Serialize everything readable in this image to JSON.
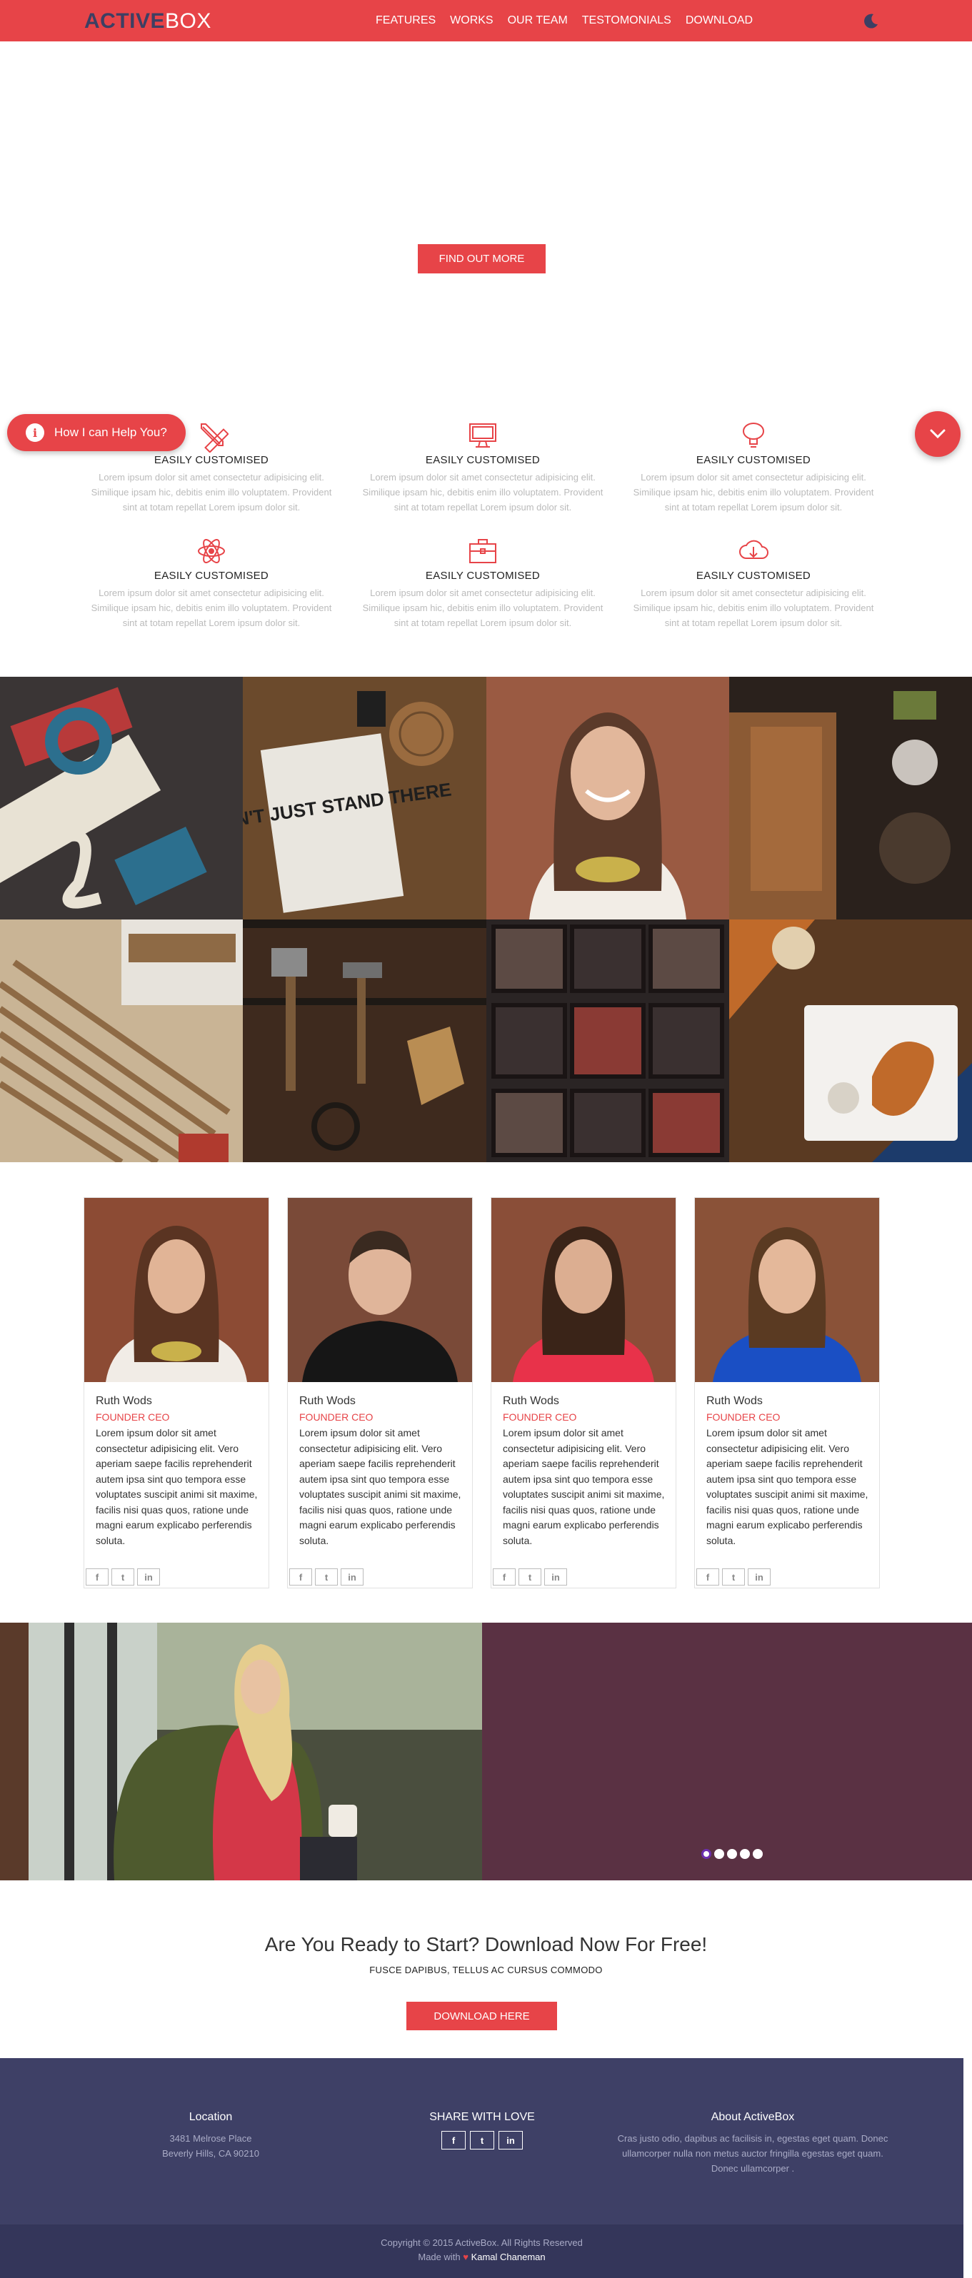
{
  "nav": {
    "logo_part1": "ACTIVE",
    "logo_part2": "BOX",
    "items": [
      "FEATURES",
      "WORKS",
      "OUR TEAM",
      "TESTOMONIALS",
      "DOWNLOAD"
    ],
    "theme_icon": "moon-icon"
  },
  "hero": {
    "button_label": "FIND OUT MORE"
  },
  "help_widget": {
    "label": "How I can Help You?",
    "icon": "info-icon"
  },
  "features": [
    {
      "icon": "pencil-ruler-icon",
      "title": "EASILY CUSTOMISED",
      "text": "Lorem ipsum dolor sit amet consectetur adipisicing elit. Similique ipsam hic, debitis enim illo voluptatem. Provident sint at totam repellat Lorem ipsum dolor sit."
    },
    {
      "icon": "monitor-icon",
      "title": "EASILY CUSTOMISED",
      "text": "Lorem ipsum dolor sit amet consectetur adipisicing elit. Similique ipsam hic, debitis enim illo voluptatem. Provident sint at totam repellat Lorem ipsum dolor sit."
    },
    {
      "icon": "lightbulb-icon",
      "title": "EASILY CUSTOMISED",
      "text": "Lorem ipsum dolor sit amet consectetur adipisicing elit. Similique ipsam hic, debitis enim illo voluptatem. Provident sint at totam repellat Lorem ipsum dolor sit."
    },
    {
      "icon": "atom-icon",
      "title": "EASILY CUSTOMISED",
      "text": "Lorem ipsum dolor sit amet consectetur adipisicing elit. Similique ipsam hic, debitis enim illo voluptatem. Provident sint at totam repellat Lorem ipsum dolor sit."
    },
    {
      "icon": "briefcase-icon",
      "title": "EASILY CUSTOMISED",
      "text": "Lorem ipsum dolor sit amet consectetur adipisicing elit. Similique ipsam hic, debitis enim illo voluptatem. Provident sint at totam repellat Lorem ipsum dolor sit."
    },
    {
      "icon": "cloud-download-icon",
      "title": "EASILY CUSTOMISED",
      "text": "Lorem ipsum dolor sit amet consectetur adipisicing elit. Similique ipsam hic, debitis enim illo voluptatem. Provident sint at totam repellat Lorem ipsum dolor sit."
    }
  ],
  "gallery": {
    "tiles": [
      {
        "subject": "stickers and ampersands on desk",
        "colors": [
          "#3a3535",
          "#b83a3a",
          "#2c6f8e",
          "#e8e2d4"
        ]
      },
      {
        "subject": "notebook 'DON'T JUST STAND THERE' on wood",
        "colors": [
          "#6b4a2c",
          "#e9e6df",
          "#1f1f1f",
          "#9a6b3f"
        ]
      },
      {
        "subject": "smiling woman portrait",
        "colors": [
          "#9a5a42",
          "#f2ede6",
          "#5b3a2a",
          "#e2b79b"
        ]
      },
      {
        "subject": "kitchen table from above",
        "colors": [
          "#2a211c",
          "#8b5a34",
          "#4a3a2e",
          "#c9c3bd"
        ]
      },
      {
        "subject": "pencils and wooden sign",
        "colors": [
          "#c9b495",
          "#8e6a45",
          "#e7e3dc",
          "#b03a2e"
        ]
      },
      {
        "subject": "vintage tools on wood",
        "colors": [
          "#3e2a1e",
          "#7a5a3a",
          "#b98d53",
          "#1e1915"
        ]
      },
      {
        "subject": "letterpress type drawer",
        "colors": [
          "#2a2424",
          "#5c4a44",
          "#8a3a34",
          "#3a3030"
        ]
      },
      {
        "subject": "breakfast plate on table",
        "colors": [
          "#5a3a22",
          "#f3f1ee",
          "#1c3b6b",
          "#c06a2a"
        ]
      }
    ],
    "theme_text": "DON'T JUST STAND THERE"
  },
  "team": [
    {
      "name": "Ruth Wods",
      "role": "FOUNDER CEO",
      "bio": "Lorem ipsum dolor sit amet consectetur adipisicing elit. Vero aperiam saepe facilis reprehenderit autem ipsa sint quo tempora esse voluptates suscipit animi sit maxime, facilis nisi quas quos, ratione unde magni earum explicabo perferendis soluta.",
      "photo_colors": [
        "#8c4b34",
        "#f1ece6",
        "#5a3422",
        "#e1b496"
      ]
    },
    {
      "name": "Ruth Wods",
      "role": "FOUNDER CEO",
      "bio": "Lorem ipsum dolor sit amet consectetur adipisicing elit. Vero aperiam saepe facilis reprehenderit autem ipsa sint quo tempora esse voluptates suscipit animi sit maxime, facilis nisi quas quos, ratione unde magni earum explicabo perferendis soluta.",
      "photo_colors": [
        "#7a4a38",
        "#161616",
        "#3a2a20",
        "#e0b59a"
      ]
    },
    {
      "name": "Ruth Wods",
      "role": "FOUNDER CEO",
      "bio": "Lorem ipsum dolor sit amet consectetur adipisicing elit. Vero aperiam saepe facilis reprehenderit autem ipsa sint quo tempora esse voluptates suscipit animi sit maxime, facilis nisi quas quos, ratione unde magni earum explicabo perferendis soluta.",
      "photo_colors": [
        "#8a4e38",
        "#e8324a",
        "#3a2418",
        "#dcae91"
      ]
    },
    {
      "name": "Ruth Wods",
      "role": "FOUNDER CEO",
      "bio": "Lorem ipsum dolor sit amet consectetur adipisicing elit. Vero aperiam saepe facilis reprehenderit autem ipsa sint quo tempora esse voluptates suscipit animi sit maxime, facilis nisi quas quos, ratione unde magni earum explicabo perferendis soluta.",
      "photo_colors": [
        "#8a5238",
        "#1a4fc4",
        "#5a3a22",
        "#e4b89a"
      ]
    }
  ],
  "socials": {
    "facebook": "f",
    "twitter": "t",
    "linkedin": "in"
  },
  "testimonial": {
    "dot_count": 5,
    "active_dot": 0,
    "panel_color": "#5a3143"
  },
  "cta": {
    "title": "Are You Ready to Start? Download Now For Free!",
    "subtitle": "FUSCE DAPIBUS, TELLUS AC CURSUS COMMODO",
    "button_label": "DOWNLOAD HERE"
  },
  "footer": {
    "location_title": "Location",
    "location_line1": "3481 Melrose Place",
    "location_line2": "Beverly Hills, CA 90210",
    "share_title": "SHARE WITH LOVE",
    "about_title": "About ActiveBox",
    "about_text": "Cras justo odio, dapibus ac facilisis in, egestas eget quam. Donec ullamcorper nulla non metus auctor fringilla egestas eget quam. Donec ullamcorper .",
    "copyright": "Copyright © 2015 ActiveBox. All Rights Reserved",
    "made_with": "Made with",
    "heart": "♥",
    "author": "Kamal Chaneman"
  },
  "colors": {
    "accent": "#e74448",
    "footer_bg": "#3e4066",
    "footer_bottom": "#34365a",
    "muted_text": "#bbbbbb"
  }
}
